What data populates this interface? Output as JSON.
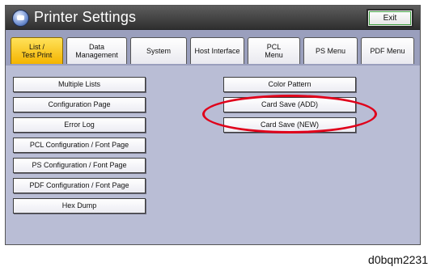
{
  "window": {
    "title": "Printer Settings",
    "exit_label": "Exit"
  },
  "tabs": [
    {
      "label": "List /\nTest Print",
      "active": true
    },
    {
      "label": "Data\nManagement",
      "active": false
    },
    {
      "label": "System",
      "active": false
    },
    {
      "label": "Host Interface",
      "active": false
    },
    {
      "label": "PCL\nMenu",
      "active": false
    },
    {
      "label": "PS Menu",
      "active": false
    },
    {
      "label": "PDF Menu",
      "active": false
    }
  ],
  "left_buttons": [
    "Multiple Lists",
    "Configuration Page",
    "Error Log",
    "PCL Configuration / Font Page",
    "PS Configuration / Font Page",
    "PDF Configuration / Font Page",
    "Hex Dump"
  ],
  "right_buttons": [
    "Color Pattern",
    "Card Save (ADD)",
    "Card Save (NEW)"
  ],
  "highlight_color": "#e0001a",
  "active_tab_color": "#f4b400",
  "caption": "d0bqm2231"
}
